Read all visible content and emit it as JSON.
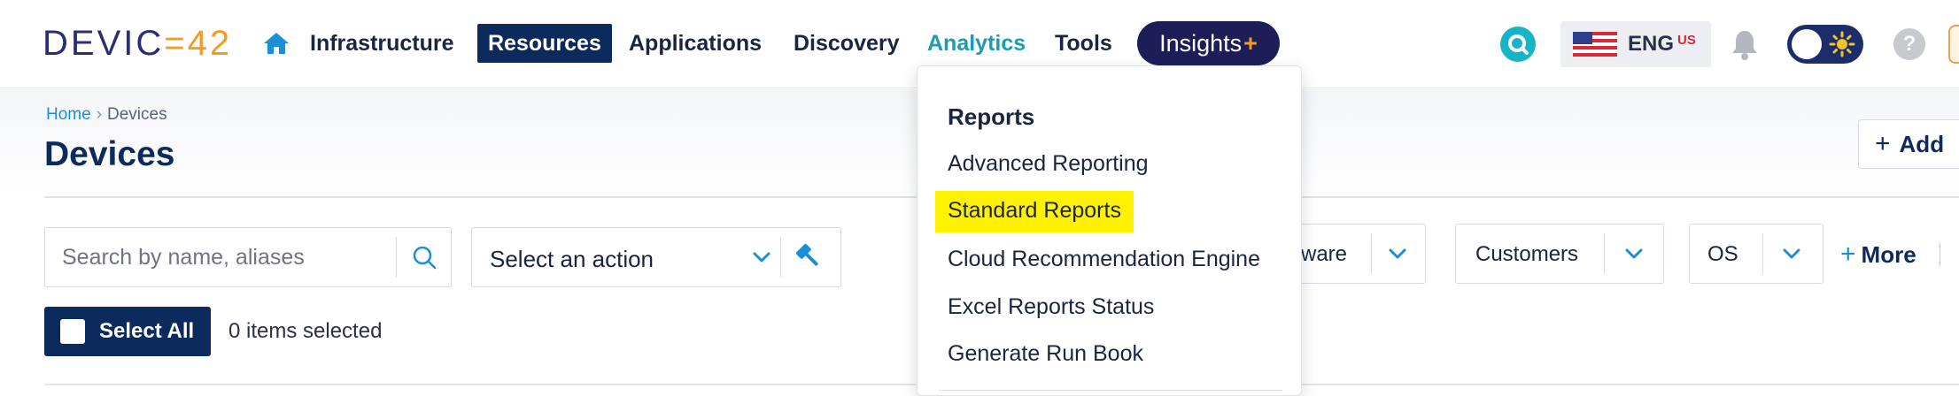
{
  "logo": {
    "part1": "DEVIC",
    "part2": "=42"
  },
  "nav": {
    "items": [
      {
        "label": "Infrastructure"
      },
      {
        "label": "Resources"
      },
      {
        "label": "Applications"
      },
      {
        "label": "Discovery"
      },
      {
        "label": "Analytics"
      },
      {
        "label": "Tools"
      }
    ],
    "insights": "Insights",
    "insights_plus": "+",
    "active": "Resources",
    "hovered": "Analytics"
  },
  "tools": {
    "language_code": "ENG",
    "language_region": "US",
    "help_label": "?"
  },
  "breadcrumb": {
    "home": "Home",
    "separator": "›",
    "current": "Devices"
  },
  "page": {
    "title": "Devices",
    "add_label": "Add",
    "add_plus": "+"
  },
  "search": {
    "placeholder": "Search by name, aliases"
  },
  "action_select": {
    "value": "Select an action"
  },
  "filters": [
    {
      "label": "ware"
    },
    {
      "label": "Customers"
    },
    {
      "label": "OS"
    }
  ],
  "more": {
    "plus": "+",
    "label": "More"
  },
  "selection": {
    "select_all": "Select All",
    "count_text": "0 items selected"
  },
  "dropdown": {
    "heading": "Reports",
    "items": [
      {
        "label": "Advanced Reporting"
      },
      {
        "label": "Standard Reports"
      },
      {
        "label": "Cloud Recommendation Engine"
      },
      {
        "label": "Excel Reports Status"
      },
      {
        "label": "Generate Run Book"
      }
    ],
    "highlighted": "Standard Reports"
  },
  "colors": {
    "navy": "#0d2a5c",
    "analytics_teal": "#1b9bb4",
    "accent_orange": "#f39b22",
    "highlight_yellow": "#fff200",
    "insights_bg": "#1d1d58"
  }
}
